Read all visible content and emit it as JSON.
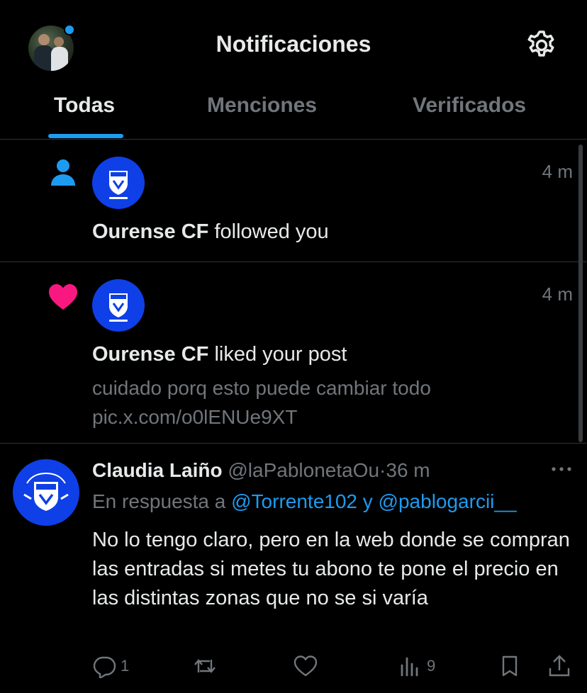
{
  "header": {
    "title": "Notificaciones",
    "tabs": [
      {
        "label": "Todas",
        "active": true
      },
      {
        "label": "Menciones",
        "active": false
      },
      {
        "label": "Verificados",
        "active": false
      }
    ]
  },
  "notifications": [
    {
      "kind": "follow",
      "kind_icon": "person-icon",
      "time": "4 m",
      "actor": "Ourense CF",
      "action": "followed you"
    },
    {
      "kind": "like",
      "kind_icon": "heart-icon",
      "time": "4 m",
      "actor": "Ourense CF",
      "action": "liked your post",
      "quote_line1": "cuidado porq esto puede cambiar todo",
      "quote_line2": "pic.x.com/o0lENUe9XT"
    }
  ],
  "tweet": {
    "name": "Claudia Laiño",
    "handle": "@laPablonetaOu",
    "separator": "·",
    "ago": "36 m",
    "reply_prefix": "En respuesta a",
    "mention1": "@Torrente102",
    "reply_and": "y",
    "mention2": "@pablogarcii__",
    "body": "No lo tengo claro, pero en la web donde se compran las entradas si metes tu abono te pone el precio en las distintas zonas que no se si varía",
    "replies": "1",
    "reposts": "",
    "likes": "",
    "views": "9"
  },
  "colors": {
    "background": "#000000",
    "accent": "#1d9bf0",
    "like": "#f91880",
    "muted": "#71767b",
    "club_blue": "#0f3fe6"
  },
  "icons": {
    "settings": "gear-icon",
    "reply": "reply-icon",
    "repost": "repost-icon",
    "like": "like-icon",
    "views": "views-icon",
    "bookmark": "bookmark-icon",
    "share": "share-icon",
    "more": "more-icon"
  }
}
